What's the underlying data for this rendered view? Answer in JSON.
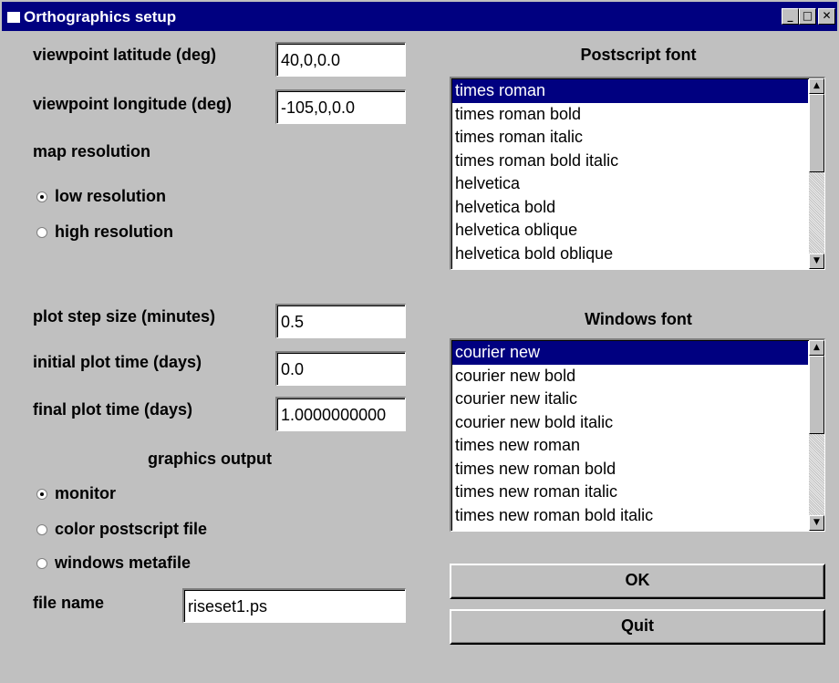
{
  "window": {
    "title": "Orthographics setup",
    "controls": {
      "minimize": "_",
      "maximize": "□",
      "close": "✕"
    }
  },
  "fields": {
    "latitude": {
      "label": "viewpoint latitude (deg)",
      "value": "40,0,0.0"
    },
    "longitude": {
      "label": "viewpoint longitude (deg)",
      "value": "-105,0,0.0"
    },
    "step": {
      "label": "plot step size (minutes)",
      "value": "0.5"
    },
    "initial": {
      "label": "initial plot time (days)",
      "value": "0.0"
    },
    "final": {
      "label": "final plot time (days)",
      "value": "1.0000000000"
    },
    "filename": {
      "label": "file name",
      "value": "riseset1.ps"
    }
  },
  "map_resolution": {
    "label": "map resolution",
    "options": [
      {
        "label": "low resolution",
        "selected": true
      },
      {
        "label": "high resolution",
        "selected": false
      }
    ]
  },
  "graphics_output": {
    "label": "graphics output",
    "options": [
      {
        "label": "monitor",
        "selected": true
      },
      {
        "label": "color postscript file",
        "selected": false
      },
      {
        "label": "windows metafile",
        "selected": false
      }
    ]
  },
  "postscript_font": {
    "label": "Postscript font",
    "items": [
      "times roman",
      "times roman bold",
      "times roman italic",
      "times roman bold italic",
      "helvetica",
      "helvetica bold",
      "helvetica oblique",
      "helvetica bold oblique"
    ],
    "selected": "times roman"
  },
  "windows_font": {
    "label": "Windows font",
    "items": [
      "courier new",
      "courier new bold",
      "courier new italic",
      "courier new bold italic",
      "times new roman",
      "times new roman bold",
      "times new roman italic",
      "times new roman bold italic"
    ],
    "selected": "courier new"
  },
  "buttons": {
    "ok": "OK",
    "quit": "Quit"
  },
  "colors": {
    "titlebar": "#000080",
    "face": "#c0c0c0",
    "selection": "#000080"
  }
}
